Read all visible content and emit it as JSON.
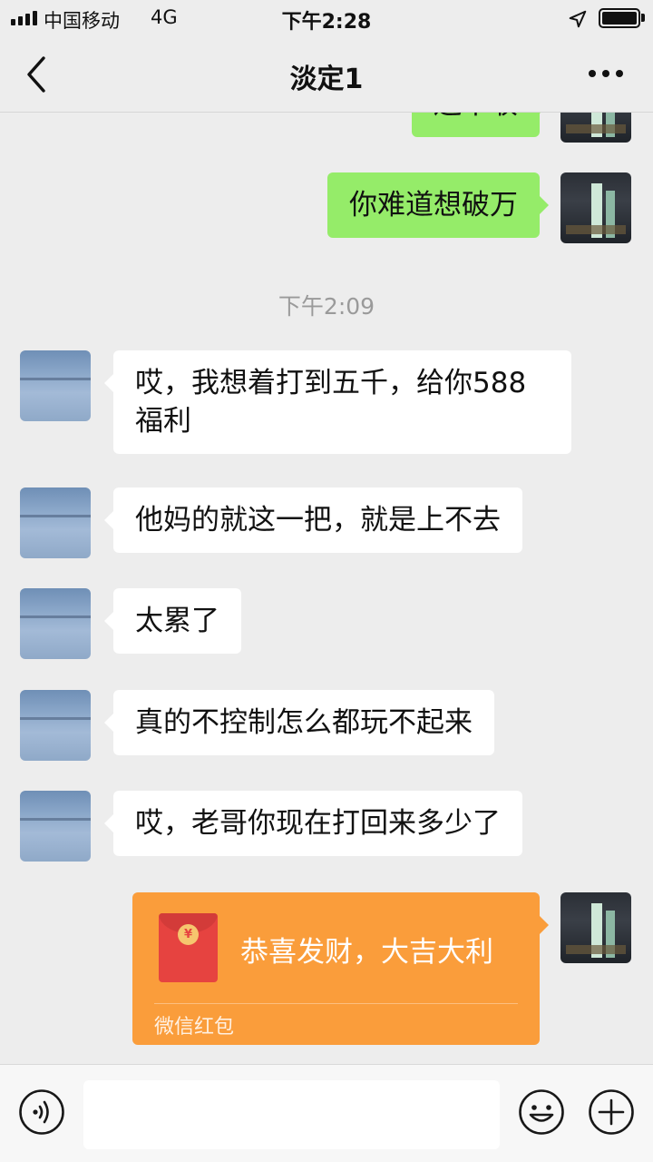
{
  "status_bar": {
    "carrier": "中国移动",
    "network": "4G",
    "time": "下午2:28",
    "battery_level": 1.0
  },
  "header": {
    "title": "淡定1",
    "back_icon": "chevron-left-icon",
    "more_icon": "ellipsis-icon"
  },
  "messages": [
    {
      "from": "self",
      "type": "text",
      "text": "还不收"
    },
    {
      "from": "self",
      "type": "text",
      "text": "你难道想破万"
    },
    {
      "type": "timestamp",
      "text": "下午2:09"
    },
    {
      "from": "contact",
      "type": "text",
      "text": "哎，我想着打到五千，给你588福利"
    },
    {
      "from": "contact",
      "type": "text",
      "text": "他妈的就这一把，就是上不去"
    },
    {
      "from": "contact",
      "type": "text",
      "text": "太累了"
    },
    {
      "from": "contact",
      "type": "text",
      "text": "真的不控制怎么都玩不起来"
    },
    {
      "from": "contact",
      "type": "text",
      "text": "哎，老哥你现在打回来多少了"
    },
    {
      "from": "self",
      "type": "red_packet",
      "text": "恭喜发财，大吉大利",
      "label": "微信红包",
      "coin_symbol": "¥"
    }
  ],
  "input_bar": {
    "value": "",
    "voice_icon": "voice-icon",
    "emoji_icon": "emoji-icon",
    "plus_icon": "plus-icon"
  },
  "colors": {
    "background": "#ededed",
    "self_bubble": "#95ec69",
    "contact_bubble": "#ffffff",
    "red_packet": "#fa9d3b",
    "red_packet_icon": "#e64340"
  }
}
